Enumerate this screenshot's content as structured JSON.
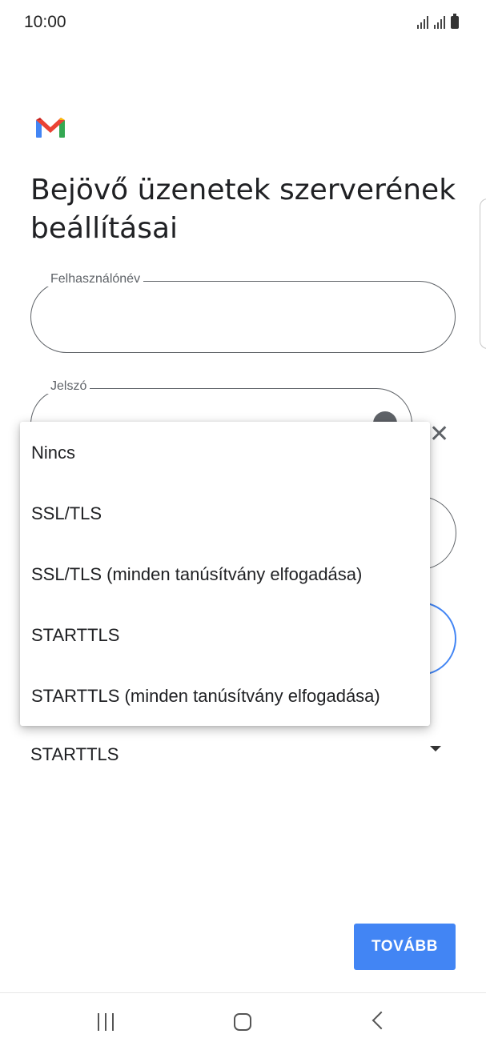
{
  "status_bar": {
    "time": "10:00"
  },
  "header": {
    "title": "Bejövő üzenetek szerverének beállításai"
  },
  "form": {
    "username_label": "Felhasználónév",
    "username_value": "",
    "password_label": "Jelszó",
    "security_value": "STARTTLS"
  },
  "dropdown": {
    "options": [
      "Nincs",
      "SSL/TLS",
      "SSL/TLS (minden tanúsítvány elfogadása)",
      "STARTTLS",
      "STARTTLS (minden tanúsítvány elfogadása)"
    ]
  },
  "actions": {
    "next_label": "TOVÁBB"
  },
  "colors": {
    "accent": "#4285f4",
    "gmail_red": "#ea4335",
    "gmail_green": "#34a853",
    "gmail_yellow": "#fbbc04",
    "gmail_blue": "#4285f4"
  }
}
